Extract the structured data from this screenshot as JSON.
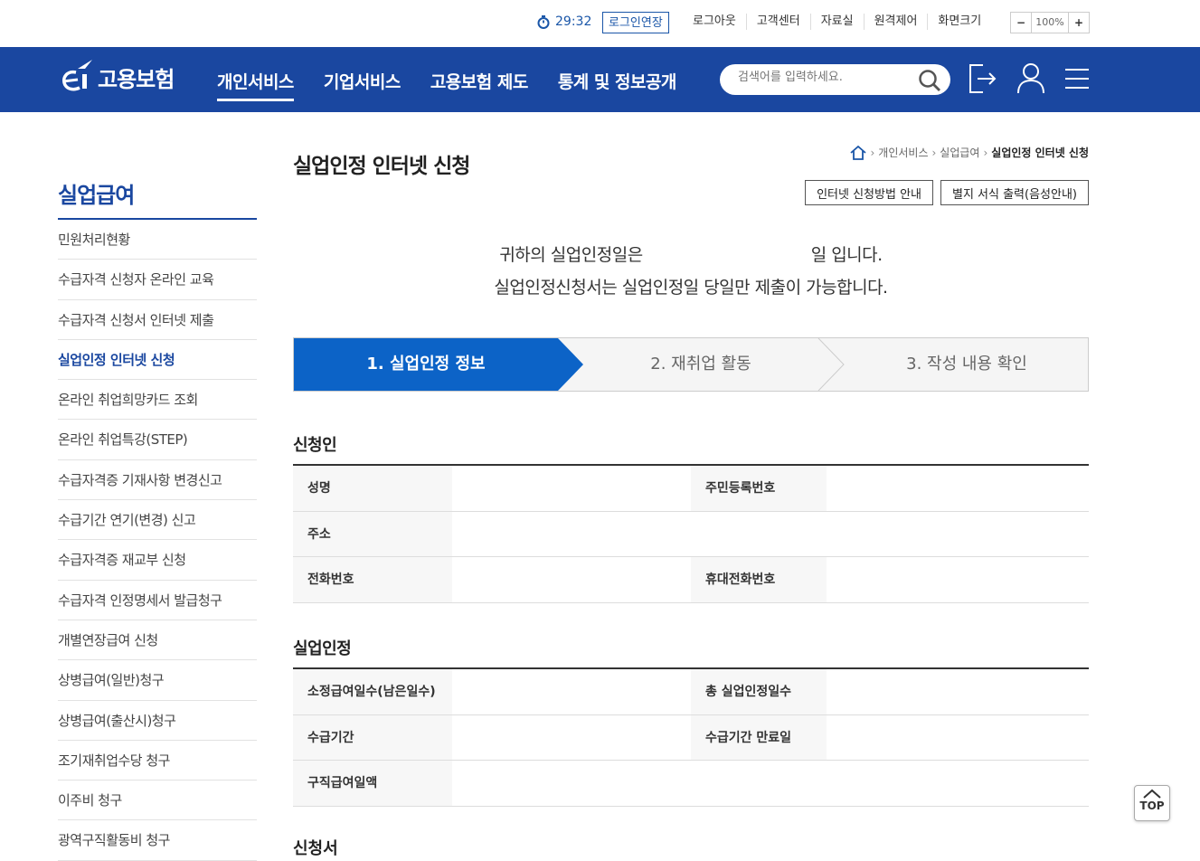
{
  "util": {
    "timer": "29:32",
    "extend_label": "로그인연장",
    "links": [
      "로그아웃",
      "고객센터",
      "자료실",
      "원격제어",
      "화면크기"
    ],
    "zoom_minus": "−",
    "zoom_value": "100%",
    "zoom_plus": "+"
  },
  "gnb": {
    "logo_text": "고용보험",
    "menu": [
      "개인서비스",
      "기업서비스",
      "고용보험 제도",
      "통계 및 정보공개"
    ],
    "search_placeholder": "검색어를 입력하세요."
  },
  "lnb": {
    "title": "실업급여",
    "items": [
      "민원처리현황",
      "수급자격 신청자 온라인 교육",
      "수급자격 신청서 인터넷 제출",
      "실업인정 인터넷 신청",
      "온라인 취업희망카드 조회",
      "온라인 취업특강(STEP)",
      "수급자격증 기재사항 변경신고",
      "수급기간 연기(변경) 신고",
      "수급자격증 재교부 신청",
      "수급자격 인정명세서 발급청구",
      "개별연장급여 신청",
      "상병급여(일반)청구",
      "상병급여(출산시)청구",
      "조기재취업수당 청구",
      "이주비 청구",
      "광역구직활동비 청구"
    ],
    "active_index": 3
  },
  "content": {
    "title": "실업인정 인터넷 신청",
    "breadcrumb": [
      "개인서비스",
      "실업급여",
      "실업인정 인터넷 신청"
    ],
    "btn_guide": "인터넷 신청방법 안내",
    "btn_print": "별지 서식 출력(음성안내)",
    "notice_pre": "귀하의 실업인정일은",
    "notice_post": "일 입니다.",
    "notice_line2": "실업인정신청서는 실업인정일 당일만 제출이 가능합니다.",
    "steps": [
      "1. 실업인정 정보",
      "2. 재취업 활동",
      "3. 작성 내용 확인"
    ],
    "active_step": 0,
    "section1": "신청인",
    "applicant": {
      "name": "성명",
      "rrn": "주민등록번호",
      "address": "주소",
      "phone": "전화번호",
      "mobile": "휴대전화번호"
    },
    "section2": "실업인정",
    "unemp": {
      "days": "소정급여일수(남은일수)",
      "total": "총 실업인정일수",
      "period": "수급기간",
      "expire": "수급기간 만료일",
      "daily": "구직급여일액"
    },
    "section3": "신청서"
  },
  "top_label": "TOP"
}
